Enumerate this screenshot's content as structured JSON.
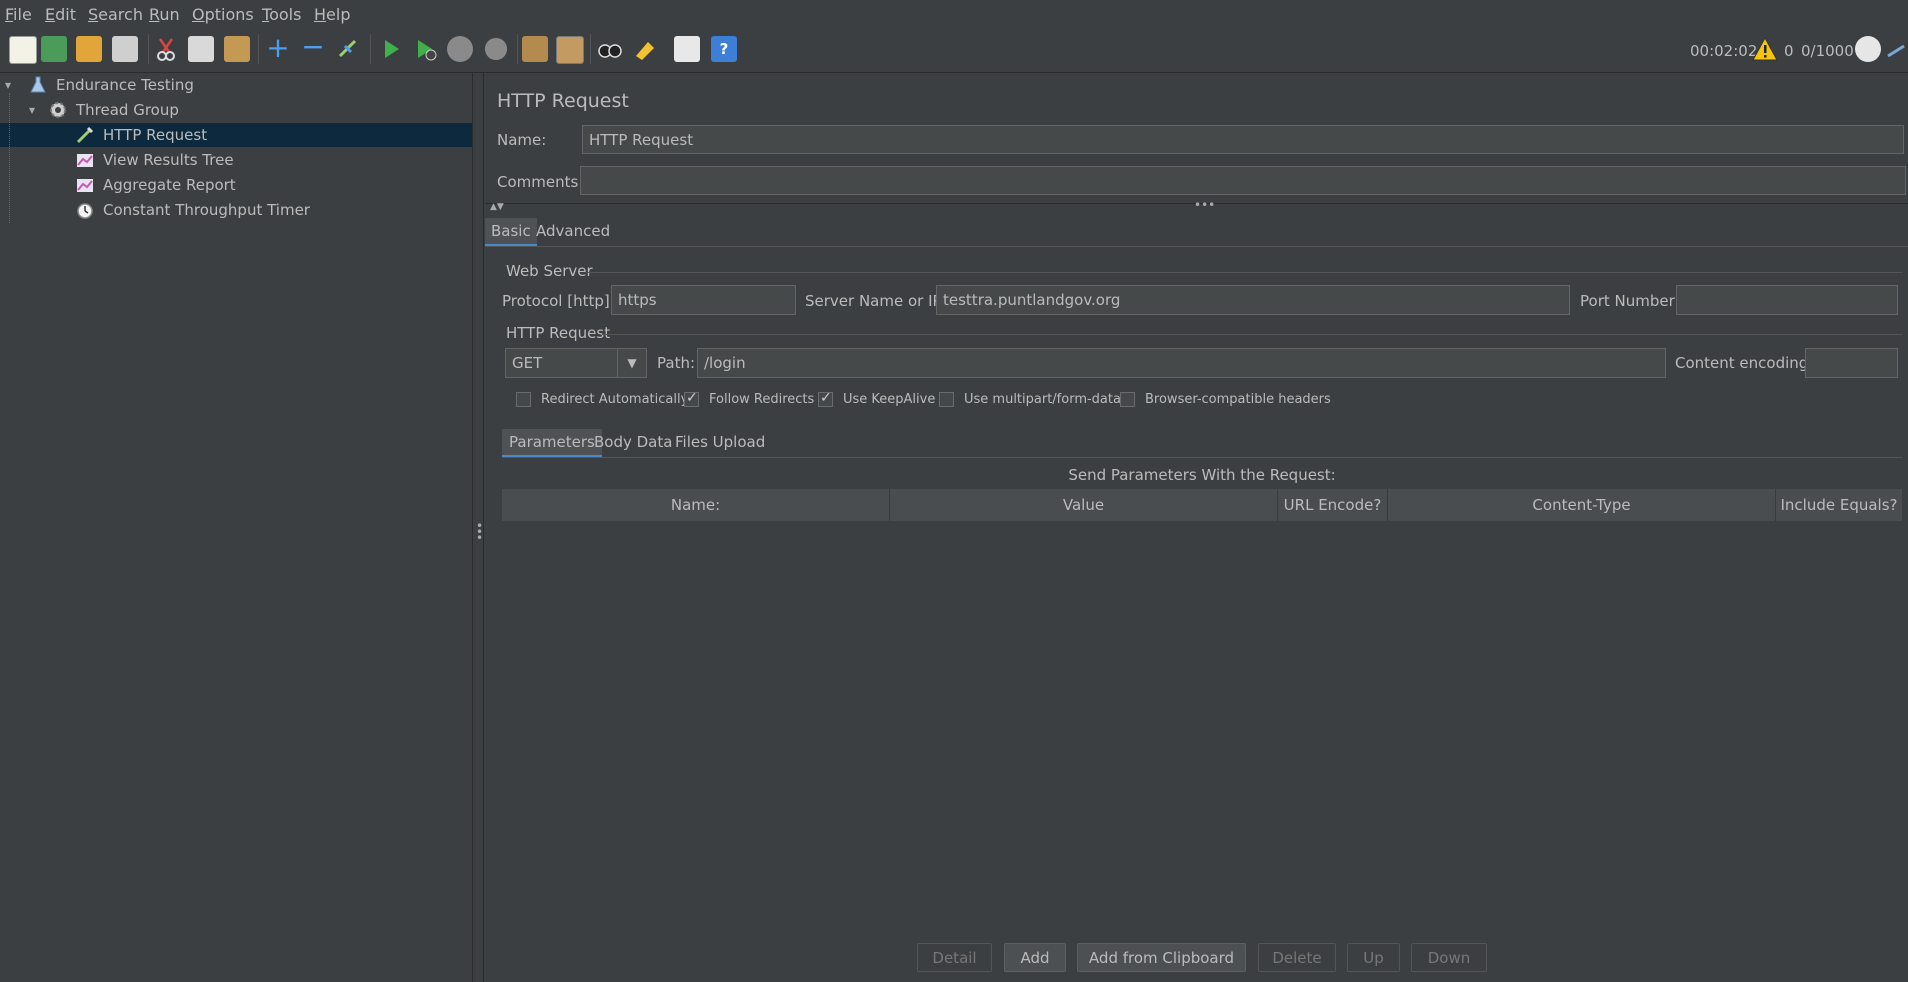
{
  "menu": [
    {
      "label": "File",
      "mnemonic": "F",
      "rest": "ile"
    },
    {
      "label": "Edit",
      "mnemonic": "E",
      "rest": "dit"
    },
    {
      "label": "Search",
      "mnemonic": "S",
      "rest": "earch"
    },
    {
      "label": "Run",
      "mnemonic": "R",
      "rest": "un"
    },
    {
      "label": "Options",
      "mnemonic": "O",
      "rest": "ptions"
    },
    {
      "label": "Tools",
      "mnemonic": "T",
      "rest": "ools"
    },
    {
      "label": "Help",
      "mnemonic": "H",
      "rest": "elp"
    }
  ],
  "status": {
    "elapsed": "00:02:02",
    "warnings": "0",
    "threads": "0/1000"
  },
  "tree": {
    "root": "Endurance Testing",
    "thread_group": "Thread Group",
    "items": [
      "HTTP Request",
      "View Results Tree",
      "Aggregate Report",
      "Constant Throughput Timer"
    ]
  },
  "panel": {
    "title": "HTTP Request",
    "name_label": "Name:",
    "name_value": "HTTP Request",
    "comments_label": "Comments:",
    "comments_value": "",
    "tabs": [
      "Basic",
      "Advanced"
    ],
    "web_server": {
      "title": "Web Server",
      "protocol_label": "Protocol [http]:",
      "protocol_value": "https",
      "server_label": "Server Name or IP:",
      "server_value": "testtra.puntlandgov.org",
      "port_label": "Port Number:",
      "port_value": ""
    },
    "http_request": {
      "title": "HTTP Request",
      "method": "GET",
      "path_label": "Path:",
      "path_value": "/login",
      "encoding_label": "Content encoding:",
      "encoding_value": ""
    },
    "options": [
      {
        "label": "Redirect Automatically",
        "checked": false
      },
      {
        "label": "Follow Redirects",
        "checked": true
      },
      {
        "label": "Use KeepAlive",
        "checked": true
      },
      {
        "label": "Use multipart/form-data",
        "checked": false
      },
      {
        "label": "Browser-compatible headers",
        "checked": false
      }
    ],
    "sub_tabs": [
      "Parameters",
      "Body Data",
      "Files Upload"
    ],
    "params_caption": "Send Parameters With the Request:",
    "columns": [
      "Name:",
      "Value",
      "URL Encode?",
      "Content-Type",
      "Include Equals?"
    ],
    "buttons": {
      "detail": "Detail",
      "add": "Add",
      "add_clipboard": "Add from Clipboard",
      "delete": "Delete",
      "up": "Up",
      "down": "Down"
    }
  }
}
